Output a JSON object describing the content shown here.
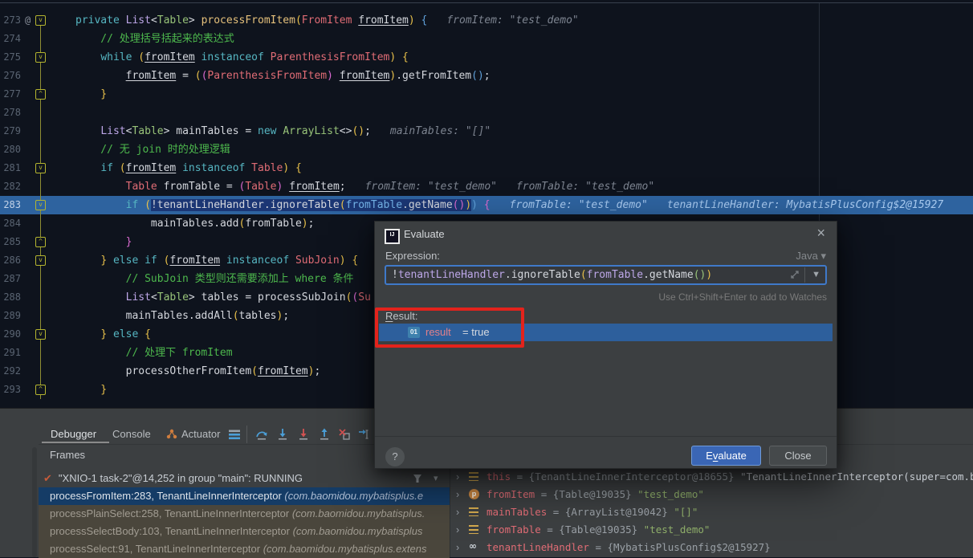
{
  "editor": {
    "lines": [
      {
        "num": "273",
        "badge": "@",
        "fold": "down",
        "hints": [
          "fromItem: \"test_demo\""
        ],
        "tokens": [
          {
            "t": "private ",
            "c": "kw"
          },
          {
            "t": "List",
            "c": "lav"
          },
          {
            "t": "<",
            "c": "pln"
          },
          {
            "t": "Table",
            "c": "clsG"
          },
          {
            "t": "> ",
            "c": "pln"
          },
          {
            "t": "processFromItem",
            "c": "mtd"
          },
          {
            "t": "(",
            "c": "parY"
          },
          {
            "t": "FromItem ",
            "c": "clsR"
          },
          {
            "t": "fromItem",
            "c": "pln",
            "u": true
          },
          {
            "t": ") ",
            "c": "parY"
          },
          {
            "t": "{",
            "c": "parB"
          }
        ]
      },
      {
        "num": "274",
        "tokens": [
          {
            "t": "    // 处理括号括起来的表达式",
            "c": "com"
          }
        ]
      },
      {
        "num": "275",
        "fold": "down",
        "tokens": [
          {
            "t": "    ",
            "c": "pln"
          },
          {
            "t": "while ",
            "c": "kw"
          },
          {
            "t": "(",
            "c": "parY"
          },
          {
            "t": "fromItem",
            "c": "pln",
            "u": true
          },
          {
            "t": " instanceof ",
            "c": "kw"
          },
          {
            "t": "ParenthesisFromItem",
            "c": "clsR"
          },
          {
            "t": ") ",
            "c": "parY"
          },
          {
            "t": "{",
            "c": "parY"
          }
        ]
      },
      {
        "num": "276",
        "tokens": [
          {
            "t": "        ",
            "c": "pln"
          },
          {
            "t": "fromItem",
            "c": "pln",
            "u": true
          },
          {
            "t": " = ",
            "c": "pln"
          },
          {
            "t": "(",
            "c": "parY"
          },
          {
            "t": "(",
            "c": "parM"
          },
          {
            "t": "ParenthesisFromItem",
            "c": "clsR"
          },
          {
            "t": ")",
            "c": "parM"
          },
          {
            "t": " ",
            "c": "pln"
          },
          {
            "t": "fromItem",
            "c": "pln",
            "u": true
          },
          {
            "t": ")",
            "c": "parY"
          },
          {
            "t": ".getFromItem",
            "c": "pln"
          },
          {
            "t": "(",
            "c": "parB"
          },
          {
            "t": ")",
            "c": "parB"
          },
          {
            "t": ";",
            "c": "pln"
          }
        ]
      },
      {
        "num": "277",
        "fold": "up",
        "tokens": [
          {
            "t": "    }",
            "c": "parY"
          }
        ]
      },
      {
        "num": "278",
        "tokens": []
      },
      {
        "num": "279",
        "hints": [
          "mainTables: \"[]\""
        ],
        "tokens": [
          {
            "t": "    ",
            "c": "pln"
          },
          {
            "t": "List",
            "c": "lav"
          },
          {
            "t": "<",
            "c": "pln"
          },
          {
            "t": "Table",
            "c": "clsG"
          },
          {
            "t": "> ",
            "c": "pln"
          },
          {
            "t": "mainTables",
            "c": "pln"
          },
          {
            "t": " = ",
            "c": "pln"
          },
          {
            "t": "new ",
            "c": "kw"
          },
          {
            "t": "ArrayList",
            "c": "clsG"
          },
          {
            "t": "<>",
            "c": "pln"
          },
          {
            "t": "(",
            "c": "parY"
          },
          {
            "t": ")",
            "c": "parY"
          },
          {
            "t": ";",
            "c": "pln"
          }
        ]
      },
      {
        "num": "280",
        "tokens": [
          {
            "t": "    // 无 join 时的处理逻辑",
            "c": "com"
          }
        ]
      },
      {
        "num": "281",
        "fold": "down",
        "tokens": [
          {
            "t": "    ",
            "c": "pln"
          },
          {
            "t": "if ",
            "c": "kw"
          },
          {
            "t": "(",
            "c": "parY"
          },
          {
            "t": "fromItem",
            "c": "pln",
            "u": true
          },
          {
            "t": " instanceof ",
            "c": "kw"
          },
          {
            "t": "Table",
            "c": "clsR"
          },
          {
            "t": ") ",
            "c": "parY"
          },
          {
            "t": "{",
            "c": "parY"
          }
        ]
      },
      {
        "num": "282",
        "hints": [
          "fromItem: \"test_demo\"",
          "fromTable: \"test_demo\""
        ],
        "tokens": [
          {
            "t": "        ",
            "c": "pln"
          },
          {
            "t": "Table ",
            "c": "clsR"
          },
          {
            "t": "fromTable",
            "c": "pln"
          },
          {
            "t": " = ",
            "c": "pln"
          },
          {
            "t": "(",
            "c": "parM"
          },
          {
            "t": "Table",
            "c": "clsR"
          },
          {
            "t": ")",
            "c": "parM"
          },
          {
            "t": " ",
            "c": "pln"
          },
          {
            "t": "fromItem",
            "c": "pln",
            "u": true
          },
          {
            "t": ";",
            "c": "pln"
          }
        ]
      },
      {
        "num": "283",
        "fold": "down",
        "hl": true,
        "hints": [
          "fromTable: \"test_demo\"",
          "tenantLineHandler: MybatisPlusConfig$2@15927"
        ],
        "tokens": [
          {
            "t": "        ",
            "c": "pln"
          },
          {
            "t": "if ",
            "c": "kw"
          },
          {
            "t": "(",
            "c": "parY"
          },
          {
            "t": "!",
            "c": "pln",
            "sel": true
          },
          {
            "t": "tenantLineHandler",
            "c": "pln",
            "sel": true
          },
          {
            "t": ".ignoreTable",
            "c": "pln",
            "sel": true
          },
          {
            "t": "(",
            "c": "parY",
            "sel": true
          },
          {
            "t": "fromTable",
            "c": "var",
            "sel": true
          },
          {
            "t": ".getName",
            "c": "pln",
            "sel": true
          },
          {
            "t": "(",
            "c": "parM",
            "sel": true
          },
          {
            "t": ")",
            "c": "parM",
            "sel": true
          },
          {
            "t": ")",
            "c": "parY",
            "sel": true
          },
          {
            "t": ")",
            "c": "parB"
          },
          {
            "t": " {",
            "c": "parM"
          }
        ]
      },
      {
        "num": "284",
        "tokens": [
          {
            "t": "            ",
            "c": "pln"
          },
          {
            "t": "mainTables",
            "c": "pln"
          },
          {
            "t": ".add",
            "c": "pln"
          },
          {
            "t": "(",
            "c": "parY"
          },
          {
            "t": "fromTable",
            "c": "pln"
          },
          {
            "t": ")",
            "c": "parY"
          },
          {
            "t": ";",
            "c": "pln"
          }
        ]
      },
      {
        "num": "285",
        "fold": "up",
        "tokens": [
          {
            "t": "        }",
            "c": "parM"
          }
        ]
      },
      {
        "num": "286",
        "fold": "down",
        "tokens": [
          {
            "t": "    ",
            "c": "pln"
          },
          {
            "t": "} ",
            "c": "parY"
          },
          {
            "t": "else if ",
            "c": "kw"
          },
          {
            "t": "(",
            "c": "parY"
          },
          {
            "t": "fromItem",
            "c": "pln",
            "u": true
          },
          {
            "t": " instanceof ",
            "c": "kw"
          },
          {
            "t": "SubJoin",
            "c": "clsR"
          },
          {
            "t": ") ",
            "c": "parY"
          },
          {
            "t": "{",
            "c": "parY"
          }
        ]
      },
      {
        "num": "287",
        "tokens": [
          {
            "t": "        // SubJoin 类型则还需要添加上 where 条件",
            "c": "com"
          }
        ]
      },
      {
        "num": "288",
        "tokens": [
          {
            "t": "        ",
            "c": "pln"
          },
          {
            "t": "List",
            "c": "lav"
          },
          {
            "t": "<",
            "c": "pln"
          },
          {
            "t": "Table",
            "c": "clsG"
          },
          {
            "t": "> ",
            "c": "pln"
          },
          {
            "t": "tables",
            "c": "pln"
          },
          {
            "t": " = ",
            "c": "pln"
          },
          {
            "t": "processSubJoin",
            "c": "pln"
          },
          {
            "t": "(",
            "c": "parY"
          },
          {
            "t": "(",
            "c": "parM"
          },
          {
            "t": "Su",
            "c": "clsR"
          }
        ]
      },
      {
        "num": "289",
        "tokens": [
          {
            "t": "        ",
            "c": "pln"
          },
          {
            "t": "mainTables",
            "c": "pln"
          },
          {
            "t": ".addAll",
            "c": "pln"
          },
          {
            "t": "(",
            "c": "parY"
          },
          {
            "t": "tables",
            "c": "pln"
          },
          {
            "t": ")",
            "c": "parY"
          },
          {
            "t": ";",
            "c": "pln"
          }
        ]
      },
      {
        "num": "290",
        "fold": "down",
        "tokens": [
          {
            "t": "    ",
            "c": "pln"
          },
          {
            "t": "} ",
            "c": "parY"
          },
          {
            "t": "else",
            "c": "kw"
          },
          {
            "t": " {",
            "c": "parY"
          }
        ]
      },
      {
        "num": "291",
        "tokens": [
          {
            "t": "        // 处理下 fromItem",
            "c": "com"
          }
        ]
      },
      {
        "num": "292",
        "tokens": [
          {
            "t": "        ",
            "c": "pln"
          },
          {
            "t": "processOtherFromItem",
            "c": "pln"
          },
          {
            "t": "(",
            "c": "parY"
          },
          {
            "t": "fromItem",
            "c": "pln",
            "u": true
          },
          {
            "t": ")",
            "c": "parY"
          },
          {
            "t": ";",
            "c": "pln"
          }
        ]
      },
      {
        "num": "293",
        "fold": "up",
        "tokens": [
          {
            "t": "    }",
            "c": "parY"
          }
        ]
      }
    ]
  },
  "panel": {
    "tabs": [
      {
        "label": "Debugger",
        "active": true
      },
      {
        "label": "Console",
        "active": false
      },
      {
        "label": "Actuator",
        "active": false,
        "icon": "actuator-icon"
      }
    ],
    "frames_title": "Frames",
    "thread": {
      "text": "\"XNIO-1 task-2\"@14,252 in group \"main\": RUNNING"
    },
    "frames": [
      {
        "name": "processFromItem:283, TenantLineInnerInterceptor ",
        "pkg": "(com.baomidou.mybatisplus.e",
        "selected": true
      },
      {
        "name": "processPlainSelect:258, TenantLineInnerInterceptor ",
        "pkg": "(com.baomidou.mybatisplus.",
        "lib": true
      },
      {
        "name": "processSelectBody:103, TenantLineInnerInterceptor ",
        "pkg": "(com.baomidou.mybatisplus",
        "lib": true
      },
      {
        "name": "processSelect:91, TenantLineInnerInterceptor ",
        "pkg": "(com.baomidou.mybatisplus.extens",
        "lib": true
      }
    ]
  },
  "variables": [
    {
      "icon": "field",
      "name": "this",
      "value": " = {TenantLineInnerInterceptor@18655} ",
      "str": "\"TenantLineInnerInterceptor(super=com.baomidou.my",
      "white": true
    },
    {
      "icon": "param",
      "name": "fromItem",
      "value": " = {Table@19035} ",
      "str": "\"test_demo\""
    },
    {
      "icon": "field",
      "name": "mainTables",
      "value": " = {ArrayList@19042} ",
      "str": "\"[]\""
    },
    {
      "icon": "field",
      "name": "fromTable",
      "value": " = {Table@19035} ",
      "str": "\"test_demo\""
    },
    {
      "icon": "sync",
      "name": "tenantLineHandler",
      "value": " = {MybatisPlusConfig$2@15927}",
      "str": ""
    }
  ],
  "dialog": {
    "title": "Evaluate",
    "expression_label": "Expression:",
    "lang": "Java",
    "lang_caret": "▾",
    "expression_tokens": [
      {
        "t": "!",
        "c": "pln"
      },
      {
        "t": "tenantLineHandler",
        "c": "lav"
      },
      {
        "t": ".ignoreTable",
        "c": "pln"
      },
      {
        "t": "(",
        "c": "parY"
      },
      {
        "t": "fromTable",
        "c": "lav"
      },
      {
        "t": ".getName",
        "c": "pln"
      },
      {
        "t": "(",
        "c": "parG"
      },
      {
        "t": ")",
        "c": "parG"
      },
      {
        "t": ")",
        "c": "parY"
      }
    ],
    "watch_hint": "Use Ctrl+Shift+Enter to add to Watches",
    "result_label": {
      "mnemonic": "R",
      "rest": "esult:"
    },
    "result_row": {
      "icon": "01",
      "name": "result",
      "value": "= true"
    },
    "help_label": "?",
    "evaluate_label": {
      "pre": "E",
      "mnemonic": "v",
      "rest": "aluate"
    },
    "close_label": "Close",
    "close_icon": "×",
    "combo_caret": "▼"
  }
}
